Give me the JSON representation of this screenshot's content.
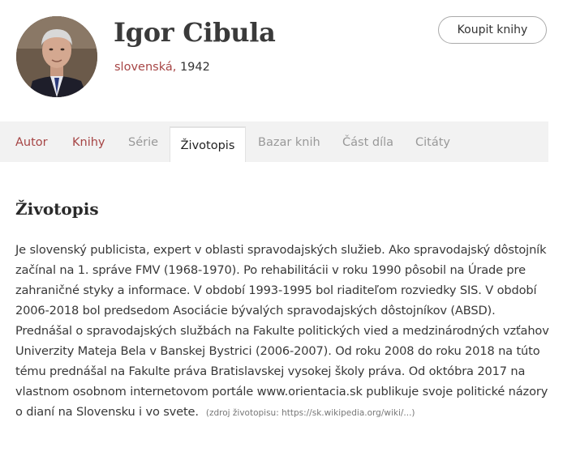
{
  "author": {
    "name": "Igor Cibula",
    "nationality": "slovenská",
    "separator": ",",
    "birth_year": "1942"
  },
  "header": {
    "buy_button_label": "Koupit knihy"
  },
  "tabs": [
    {
      "label": "Autor",
      "state": "link"
    },
    {
      "label": "Knihy",
      "state": "link"
    },
    {
      "label": "Série",
      "state": "disabled"
    },
    {
      "label": "Životopis",
      "state": "active"
    },
    {
      "label": "Bazar knih",
      "state": "disabled"
    },
    {
      "label": "Část díla",
      "state": "disabled"
    },
    {
      "label": "Citáty",
      "state": "disabled"
    }
  ],
  "biography": {
    "title": "Životopis",
    "text": "Je slovenský publicista, expert v oblasti spravodajských služieb. Ako spravodajský dôstojník začínal na 1. správe FMV (1968-1970). Po rehabilitácii v roku 1990 pôsobil na Úrade pre zahraničné styky a informace. V období 1993-1995 bol riaditeľom rozviedky SIS. V období 2006-2018 bol predsedom Asociácie bývalých spravodajských dôstojníkov (ABSD). Prednášal o spravodajských službách na Fakulte politických vied a medzinárodných vzťahov Univerzity Mateja Bela v Banskej Bystrici (2006-2007). Od roku 2008 do roku 2018 na túto tému prednášal na Fakulte práva Bratislavskej vysokej školy práva. Od októbra 2017 na vlastnom osobnom internetovom portále www.orientacia.sk publikuje svoje politické názory o dianí na Slovensku i vo svete.",
    "source": "(zdroj životopisu: https://sk.wikipedia.org/wiki/...)"
  },
  "colors": {
    "accent": "#a64545",
    "tab_bar_bg": "#f2f2f2",
    "disabled_tab": "#999999"
  }
}
